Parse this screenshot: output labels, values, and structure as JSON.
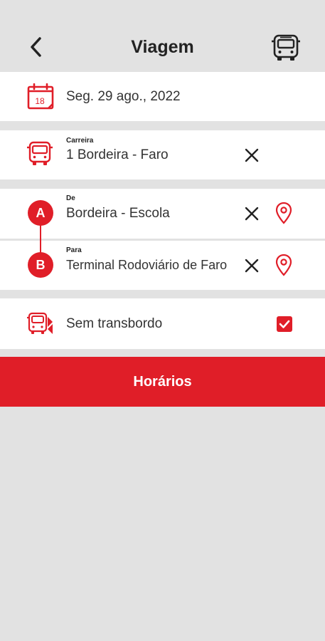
{
  "header": {
    "title": "Viagem",
    "back_icon": "chevron-left-icon",
    "bus_icon": "bus-icon"
  },
  "date": {
    "calendar_day": "18",
    "value": "Seg. 29 ago., 2022"
  },
  "route": {
    "label": "Carreira",
    "value": "1  Bordeira - Faro"
  },
  "origin": {
    "marker": "A",
    "label": "De",
    "value": "Bordeira - Escola"
  },
  "destination": {
    "marker": "B",
    "label": "Para",
    "value": "Terminal Rodoviário de Faro"
  },
  "transfer": {
    "label": "Sem transbordo",
    "checked": true
  },
  "action": {
    "label": "Horários"
  },
  "colors": {
    "accent": "#e01e28",
    "background": "#e2e2e2",
    "card": "#ffffff"
  }
}
